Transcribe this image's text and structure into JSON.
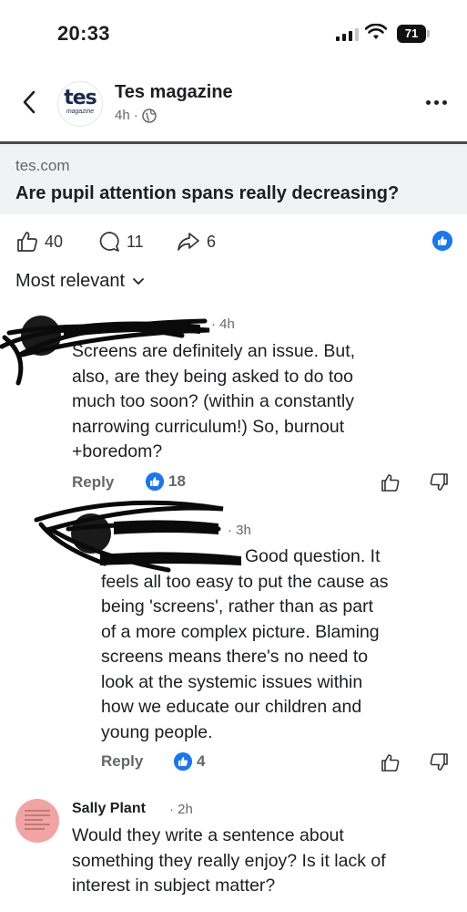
{
  "status_bar": {
    "time": "20:33",
    "battery": "71"
  },
  "header": {
    "page_name": "Tes magazine",
    "time_ago": "4h",
    "avatar_text": "tes",
    "avatar_subtext": "magazine"
  },
  "link": {
    "domain": "tes.com",
    "title": "Are pupil attention spans really decreasing?"
  },
  "reactions": {
    "likes": "40",
    "comments": "11",
    "shares": "6"
  },
  "sort": {
    "label": "Most relevant"
  },
  "comments": [
    {
      "time": "4h",
      "lines": [
        "Screens are definitely an issue. But,",
        "also, are they being asked to do too",
        "much too soon? (within a constantly",
        "narrowing curriculum!) So, burnout",
        "+boredom?"
      ],
      "reply_label": "Reply",
      "like_count": "18"
    },
    {
      "time": "3h",
      "first_line": "Good question. It",
      "lines": [
        "feels all too easy to put the cause as",
        "being 'screens', rather than as part",
        "of a more complex picture. Blaming",
        "screens means there's no need to",
        "look at the systemic issues within",
        "how we educate our children and",
        "young people."
      ],
      "reply_label": "Reply",
      "like_count": "4"
    },
    {
      "name": "Sally Plant",
      "time": "2h",
      "lines": [
        "Would they write a sentence about",
        "something they really enjoy? Is it lack of",
        "interest in subject matter?"
      ]
    }
  ]
}
